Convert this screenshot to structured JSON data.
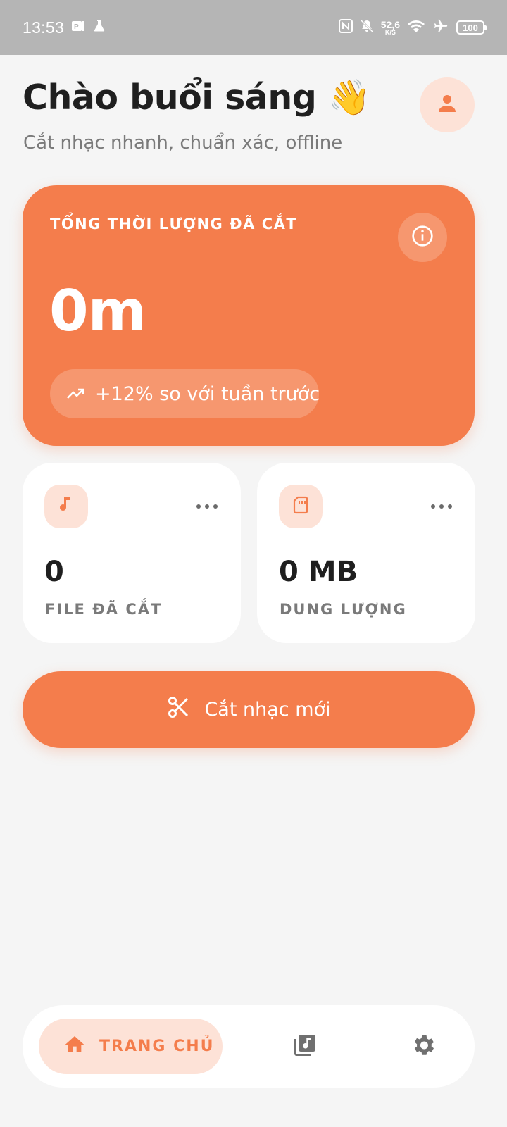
{
  "status_bar": {
    "time": "13:53",
    "net_speed_value": "52,6",
    "net_speed_unit": "K/S",
    "battery": "100",
    "icons": [
      "p-badge-icon",
      "flask-icon",
      "nfc-icon",
      "bell-off-icon",
      "wifi-icon",
      "airplane-icon",
      "battery-icon"
    ]
  },
  "header": {
    "greeting": "Chào buổi sáng 👋",
    "subtitle": "Cắt nhạc nhanh, chuẩn xác, offline",
    "avatar_icon": "person-icon"
  },
  "hero": {
    "label": "TỔNG THỜI LƯỢNG ĐÃ CẮT",
    "value": "0m",
    "trend": "+12% so với tuần trước",
    "info_icon": "info-icon",
    "trend_icon": "trending-up-icon"
  },
  "stats": [
    {
      "icon": "music-note-icon",
      "value": "0",
      "label": "FILE ĐÃ CẮT"
    },
    {
      "icon": "sd-card-icon",
      "value": "0 MB",
      "label": "DUNG LƯỢNG"
    }
  ],
  "cta": {
    "label": "Cắt nhạc mới",
    "icon": "scissors-icon"
  },
  "nav": {
    "home_label": "TRANG CHỦ",
    "items": [
      "home-icon",
      "library-music-icon",
      "settings-icon"
    ]
  },
  "colors": {
    "accent": "#f47d4c",
    "accent_soft": "#fde2d7",
    "background": "#f5f5f5",
    "status_bar": "#b5b5b5"
  }
}
